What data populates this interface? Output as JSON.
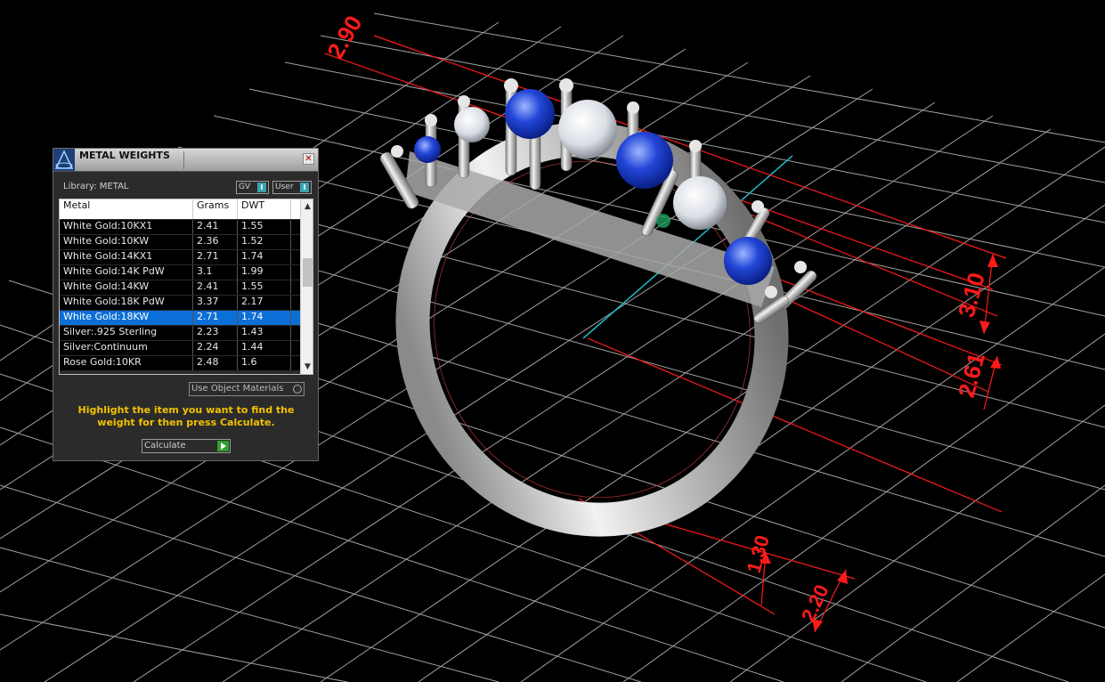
{
  "panel": {
    "title": "METAL WEIGHTS",
    "close_label": "✕",
    "library_label": "Library: METAL",
    "gv_toggle": "GV",
    "gv_indicator": "I",
    "user_toggle": "User",
    "user_indicator": "I",
    "columns": [
      "Metal",
      "Grams",
      "DWT"
    ],
    "rows": [
      {
        "metal": "White Gold:10KX1",
        "grams": "2.41",
        "dwt": "1.55"
      },
      {
        "metal": "White Gold:10KW",
        "grams": "2.36",
        "dwt": "1.52"
      },
      {
        "metal": "White Gold:14KX1",
        "grams": "2.71",
        "dwt": "1.74"
      },
      {
        "metal": "White Gold:14K PdW",
        "grams": "3.1",
        "dwt": "1.99"
      },
      {
        "metal": "White Gold:14KW",
        "grams": "2.41",
        "dwt": "1.55"
      },
      {
        "metal": "White Gold:18K PdW",
        "grams": "3.37",
        "dwt": "2.17"
      },
      {
        "metal": "White Gold:18KW",
        "grams": "2.71",
        "dwt": "1.74"
      },
      {
        "metal": "Silver:.925 Sterling",
        "grams": "2.23",
        "dwt": "1.43"
      },
      {
        "metal": "Silver:Continuum",
        "grams": "2.24",
        "dwt": "1.44"
      },
      {
        "metal": "Rose Gold:10KR",
        "grams": "2.48",
        "dwt": "1.6"
      }
    ],
    "selected_row": 6,
    "use_object_materials": "Use Object Materials",
    "hint": "Highlight the item you want to find the weight for then press Calculate.",
    "calculate_label": "Calculate"
  },
  "viewport": {
    "dimensions": [
      "2.90",
      "3.10",
      "2.61",
      "1.30",
      "2.20"
    ],
    "grid_color": "#d8d8d8",
    "dimension_color": "#ff1a1a",
    "axis_color": "#1fb8c8"
  }
}
